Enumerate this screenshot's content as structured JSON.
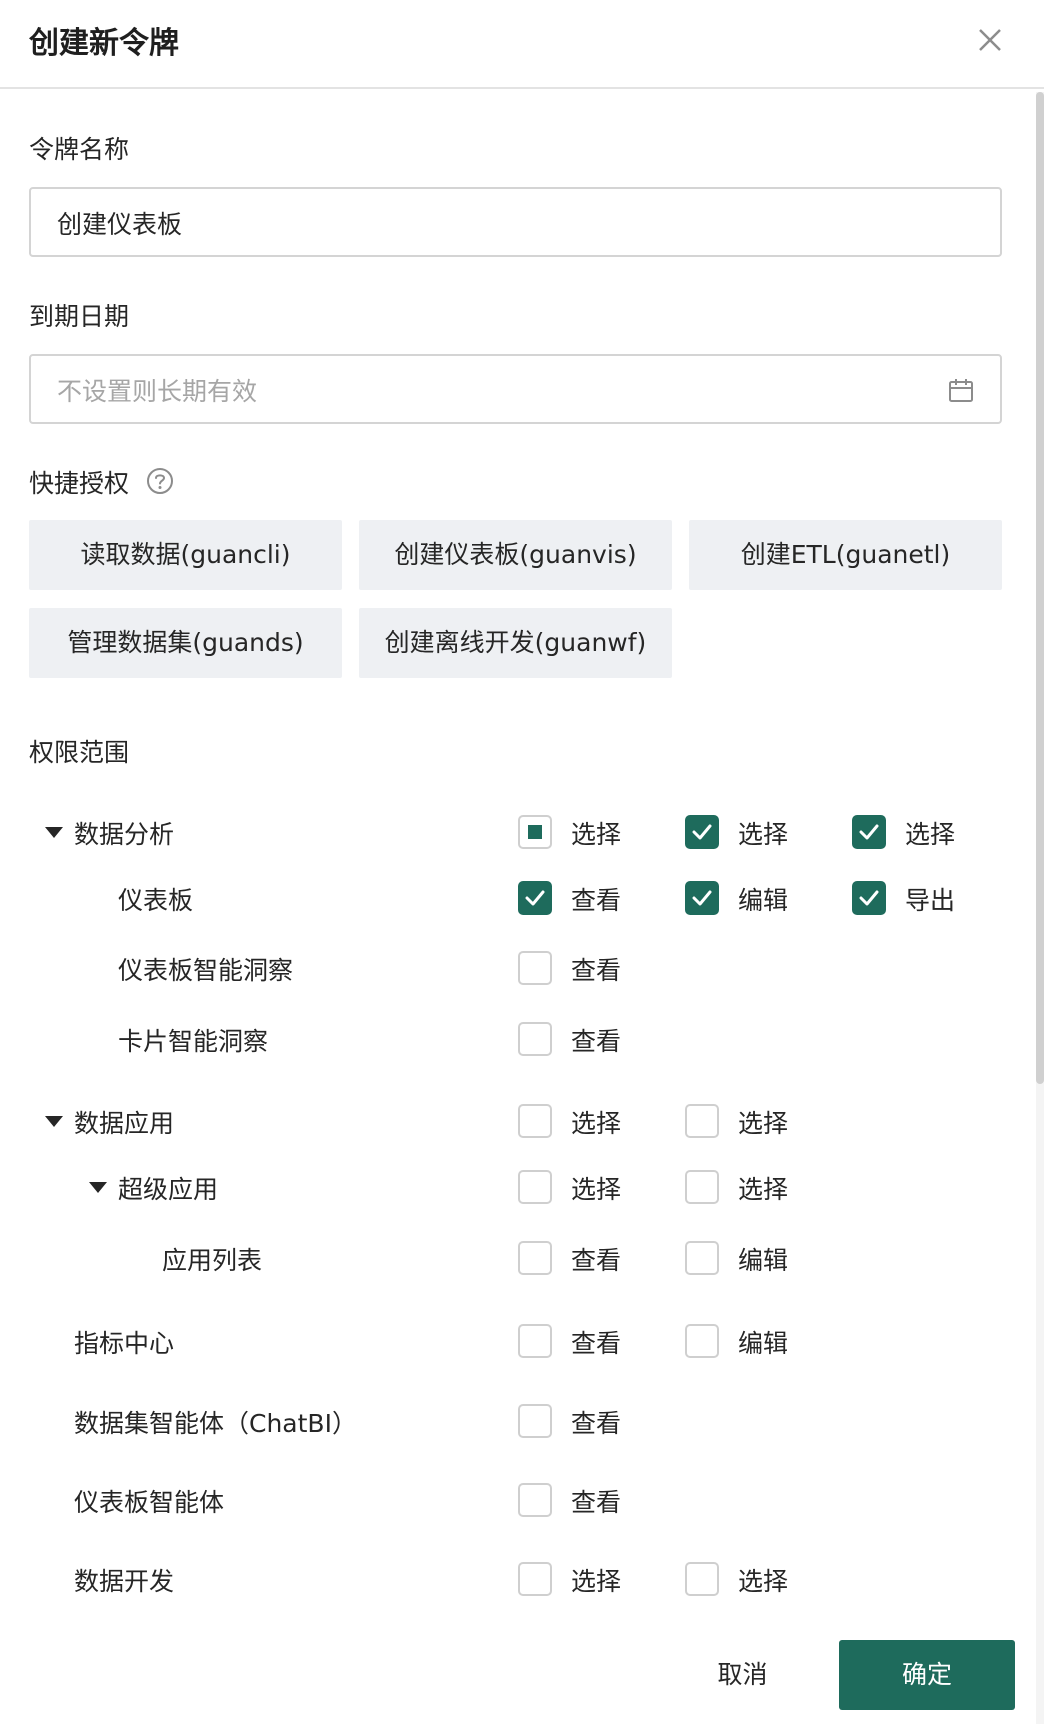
{
  "dialog": {
    "title": "创建新令牌"
  },
  "form": {
    "name_label": "令牌名称",
    "name_value": "创建仪表板",
    "expiry_label": "到期日期",
    "expiry_placeholder": "不设置则长期有效",
    "quick_label": "快捷授权",
    "quick_buttons": [
      "读取数据(guancli)",
      "创建仪表板(guanvis)",
      "创建ETL(guanetl)",
      "管理数据集(guands)",
      "创建离线开发(guanwf)"
    ],
    "scope_label": "权限范围"
  },
  "tree": [
    {
      "label": "数据分析",
      "options": [
        "选择",
        "选择",
        "选择"
      ],
      "states": [
        "indeterminate",
        "checked",
        "checked"
      ]
    },
    {
      "label": "仪表板",
      "options": [
        "查看",
        "编辑",
        "导出"
      ],
      "states": [
        "checked",
        "checked",
        "checked"
      ]
    },
    {
      "label": "仪表板智能洞察",
      "options": [
        "查看"
      ],
      "states": [
        "unchecked"
      ]
    },
    {
      "label": "卡片智能洞察",
      "options": [
        "查看"
      ],
      "states": [
        "unchecked"
      ]
    },
    {
      "label": "数据应用",
      "options": [
        "选择",
        "选择"
      ],
      "states": [
        "unchecked",
        "unchecked"
      ]
    },
    {
      "label": "超级应用",
      "options": [
        "选择",
        "选择"
      ],
      "states": [
        "unchecked",
        "unchecked"
      ]
    },
    {
      "label": "应用列表",
      "options": [
        "查看",
        "编辑"
      ],
      "states": [
        "unchecked",
        "unchecked"
      ]
    },
    {
      "label": "指标中心",
      "options": [
        "查看",
        "编辑"
      ],
      "states": [
        "unchecked",
        "unchecked"
      ]
    },
    {
      "label": "数据集智能体（ChatBI）",
      "options": [
        "查看"
      ],
      "states": [
        "unchecked"
      ]
    },
    {
      "label": "仪表板智能体",
      "options": [
        "查看"
      ],
      "states": [
        "unchecked"
      ]
    },
    {
      "label": "数据开发",
      "options": [
        "选择",
        "选择"
      ],
      "states": [
        "unchecked",
        "unchecked"
      ]
    }
  ],
  "footer": {
    "cancel_label": "取消",
    "ok_label": "确定"
  },
  "colors": {
    "accent": "#1e6b5c",
    "button_bg": "#eef0f3",
    "border": "#d4d4d4"
  }
}
